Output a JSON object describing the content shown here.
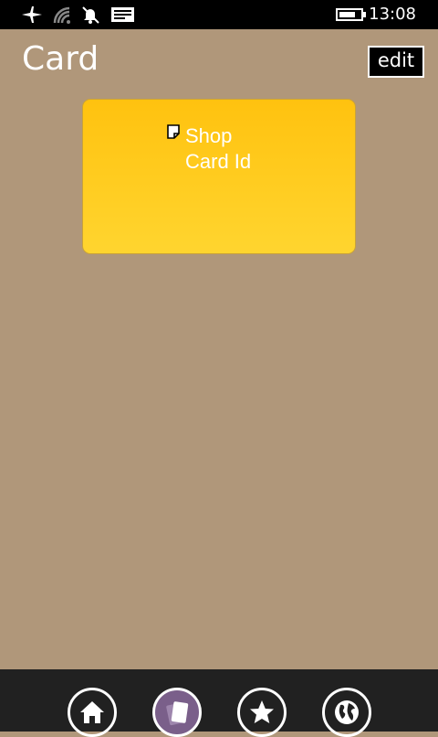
{
  "status_bar": {
    "time": "13:08",
    "icons": [
      "airplane-mode-icon",
      "wifi-signal-icon",
      "notifications-off-icon",
      "messaging-icon",
      "battery-icon"
    ]
  },
  "header": {
    "title": "Card",
    "edit_label": "edit"
  },
  "card": {
    "name": "Shop",
    "id_label": "Card Id",
    "icon": "note-icon"
  },
  "app_bar": {
    "buttons": [
      {
        "icon": "home-icon",
        "active": false
      },
      {
        "icon": "cards-icon",
        "active": true
      },
      {
        "icon": "star-icon",
        "active": false
      },
      {
        "icon": "globe-icon",
        "active": false
      }
    ]
  },
  "colors": {
    "background": "#b0977a",
    "card_top": "#ffc20f",
    "card_bottom": "#ffd52f",
    "app_bar": "#212121",
    "active_button": "#7a5f8a"
  }
}
